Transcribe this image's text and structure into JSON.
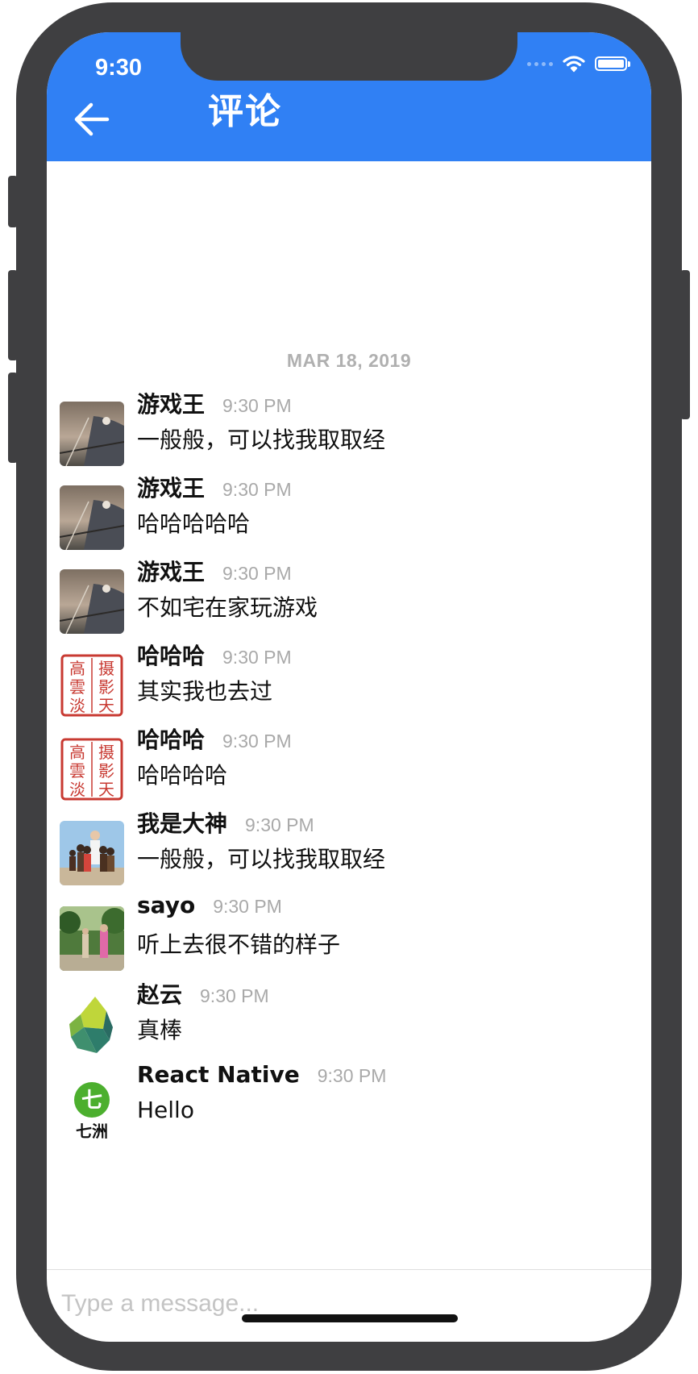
{
  "status_bar": {
    "time": "9:30"
  },
  "header": {
    "title": "评论",
    "back_icon": "arrow-left-icon",
    "background": "#3080f4"
  },
  "chat": {
    "date_label": "MAR 18, 2019",
    "messages": [
      {
        "name": "游戏王",
        "time": "9:30 PM",
        "text": "一般般，可以找我取取经",
        "avatar": "sailboat-avatar"
      },
      {
        "name": "游戏王",
        "time": "9:30 PM",
        "text": "哈哈哈哈哈",
        "avatar": "sailboat-avatar"
      },
      {
        "name": "游戏王",
        "time": "9:30 PM",
        "text": "不如宅在家玩游戏",
        "avatar": "sailboat-avatar"
      },
      {
        "name": "哈哈哈",
        "time": "9:30 PM",
        "text": "其实我也去过",
        "avatar": "red-seal-avatar",
        "seal_text": "摄影天 高雲淡"
      },
      {
        "name": "哈哈哈",
        "time": "9:30 PM",
        "text": "哈哈哈哈",
        "avatar": "red-seal-avatar",
        "seal_text": "摄影天 高雲淡"
      },
      {
        "name": "我是大神",
        "time": "9:30 PM",
        "text": "一般般，可以找我取取经",
        "avatar": "group-photo-avatar"
      },
      {
        "name": "sayo",
        "time": "9:30 PM",
        "text": "听上去很不错的样子",
        "avatar": "garden-photo-avatar"
      },
      {
        "name": "赵云",
        "time": "9:30 PM",
        "text": "真棒",
        "avatar": "green-polyhedron-logo-avatar"
      },
      {
        "name": "React Native",
        "time": "9:30 PM",
        "text": "Hello",
        "avatar": "qizhou-logo-avatar",
        "logo_text": "七洲"
      }
    ]
  },
  "composer": {
    "placeholder": "Type a message..."
  }
}
